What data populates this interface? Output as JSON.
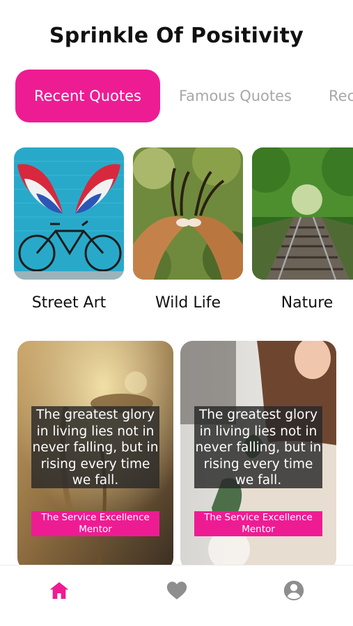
{
  "app": {
    "title": "Sprinkle Of Positivity"
  },
  "tabs": [
    {
      "label": "Recent Quotes",
      "active": true
    },
    {
      "label": "Famous Quotes",
      "active": false
    },
    {
      "label": "Rec",
      "active": false
    }
  ],
  "categories": [
    {
      "label": "Street Art"
    },
    {
      "label": "Wild Life"
    },
    {
      "label": "Nature"
    }
  ],
  "quotes": [
    {
      "text": "The greatest glory in living lies not in never falling, but in rising every time we fall.",
      "author": "The Service Excellence Mentor"
    },
    {
      "text": "The greatest glory in living lies not in never falling, but in rising every time we fall.",
      "author": "The Service Excellence Mentor"
    }
  ],
  "nav": {
    "items": [
      {
        "icon": "home-icon",
        "active": true
      },
      {
        "icon": "heart-icon",
        "active": false
      },
      {
        "icon": "account-icon",
        "active": false
      }
    ]
  },
  "colors": {
    "accent": "#ee1c93",
    "inactive_tab": "#a7a7a7",
    "nav_inactive": "#8e8e8e"
  }
}
